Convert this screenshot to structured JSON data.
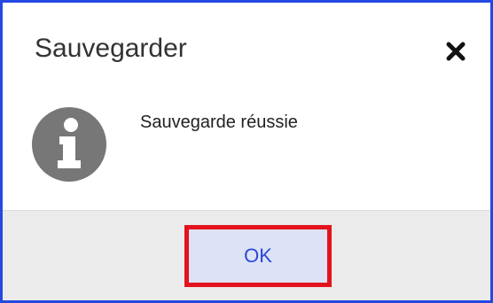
{
  "dialog": {
    "title": "Sauvegarder",
    "close_icon": "close-icon",
    "message_icon": "info-icon",
    "message": "Sauvegarde réussie",
    "ok_label": "OK"
  },
  "colors": {
    "border": "#2349e0",
    "footer_bg": "#ebebeb",
    "button_bg": "#dde2f6",
    "button_text": "#2a4ad8",
    "highlight": "#e3131d",
    "icon_gray": "#777777"
  }
}
